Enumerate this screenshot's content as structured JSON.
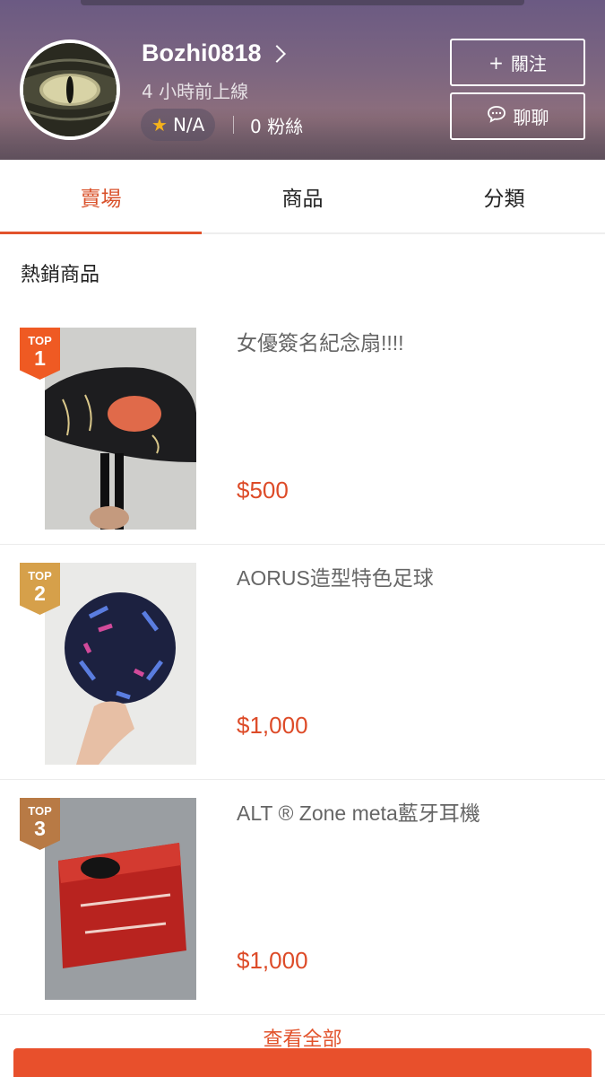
{
  "header": {
    "username": "Bozhi0818",
    "last_online": "4 小時前上線",
    "rating": "N/A",
    "fans": "0 粉絲",
    "follow_label": "關注",
    "chat_label": "聊聊"
  },
  "tabs": [
    {
      "label": "賣場",
      "active": true
    },
    {
      "label": "商品",
      "active": false
    },
    {
      "label": "分類",
      "active": false
    }
  ],
  "section_title": "熱銷商品",
  "products": [
    {
      "rank_label": "TOP",
      "rank": "1",
      "name": "女優簽名紀念扇!!!!",
      "price": "$500"
    },
    {
      "rank_label": "TOP",
      "rank": "2",
      "name": "AORUS造型特色足球",
      "price": "$1,000"
    },
    {
      "rank_label": "TOP",
      "rank": "3",
      "name": "ALT ® Zone meta藍牙耳機",
      "price": "$1,000"
    }
  ],
  "see_all": "查看全部",
  "colors": {
    "accent": "#e2532c",
    "price": "#dd4b28",
    "badge1": "#ef5a23",
    "badge2": "#d6a04a",
    "badge3": "#b87a45"
  }
}
